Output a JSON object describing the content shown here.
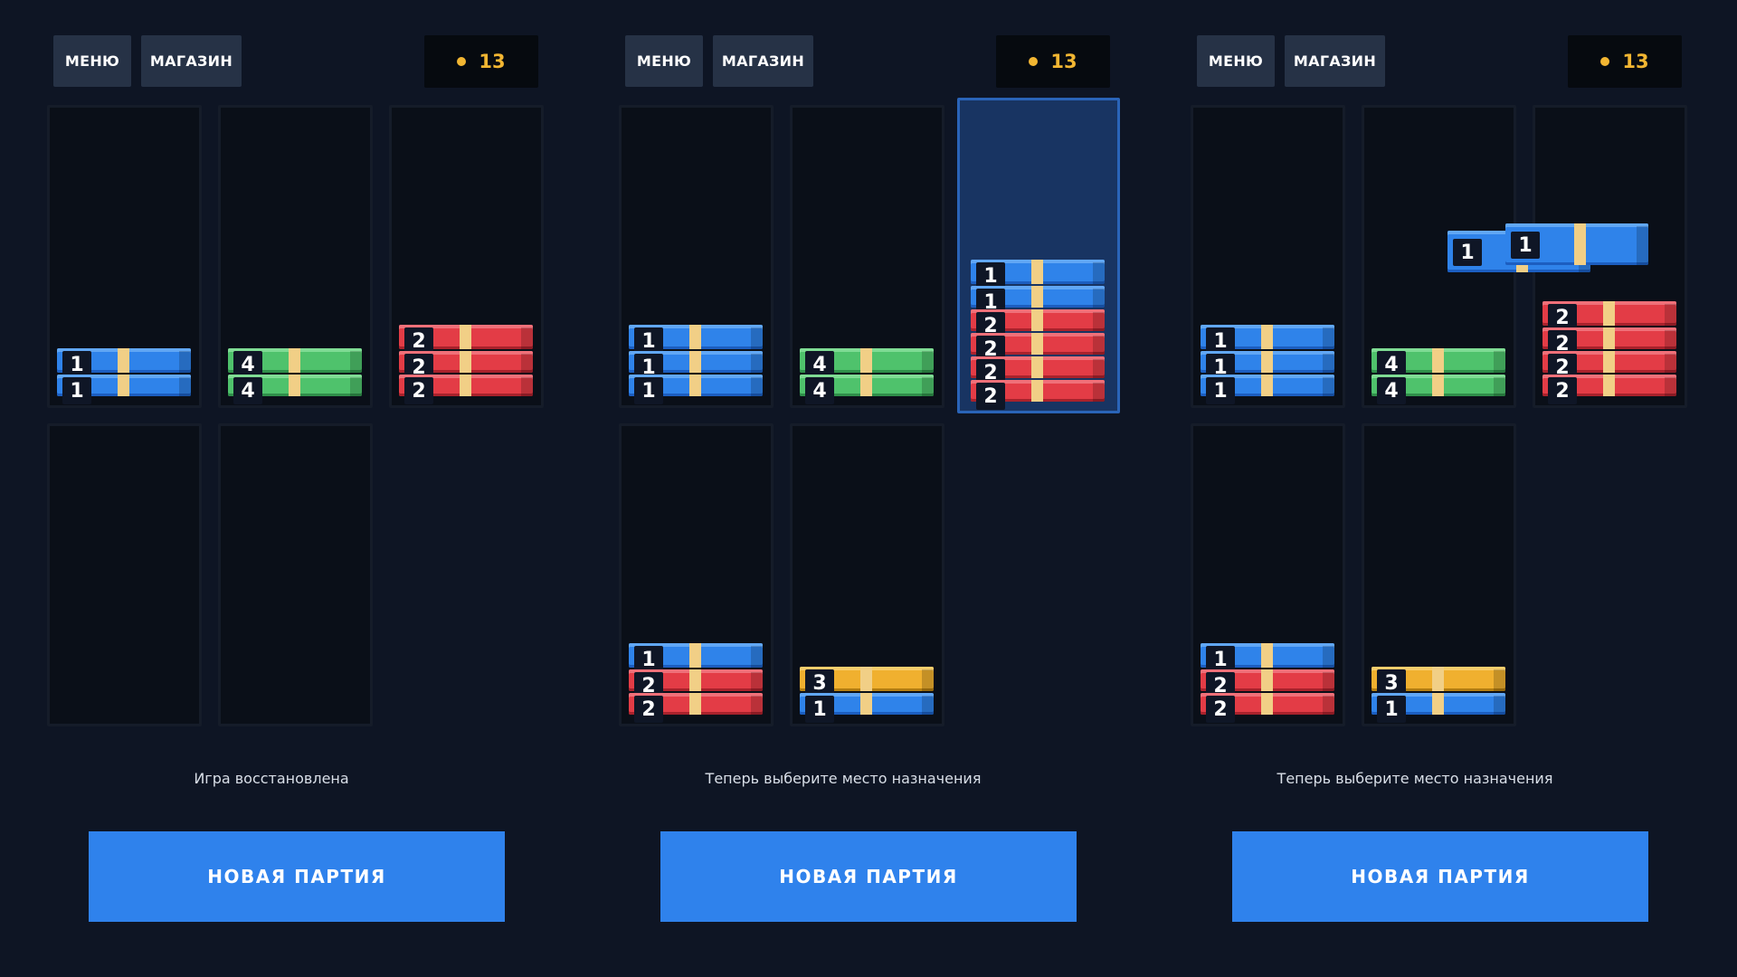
{
  "panels": [
    {
      "header": {
        "menu_label": "МЕНЮ",
        "shop_label": "МАГАЗИН",
        "coins": "13"
      },
      "status": "Игра восстановлена",
      "new_game_label": "НОВАЯ ПАРТИЯ",
      "columns": [
        {
          "selected": false,
          "bundles": [
            "1",
            "1"
          ],
          "colors": [
            "blue",
            "blue"
          ]
        },
        {
          "selected": false,
          "bundles": [
            "4",
            "4"
          ],
          "colors": [
            "green",
            "green"
          ]
        },
        {
          "selected": false,
          "bundles": [
            "2",
            "2",
            "2"
          ],
          "colors": [
            "red",
            "red",
            "red"
          ]
        },
        {
          "selected": false,
          "bundles": [],
          "colors": []
        },
        {
          "selected": false,
          "bundles": [],
          "colors": []
        }
      ]
    },
    {
      "header": {
        "menu_label": "МЕНЮ",
        "shop_label": "МАГАЗИН",
        "coins": "13"
      },
      "status": "Теперь выберите место назначения",
      "new_game_label": "НОВАЯ ПАРТИЯ",
      "columns": [
        {
          "selected": false,
          "bundles": [
            "1",
            "1",
            "1"
          ],
          "colors": [
            "blue",
            "blue",
            "blue"
          ]
        },
        {
          "selected": false,
          "bundles": [
            "4",
            "4"
          ],
          "colors": [
            "green",
            "green"
          ]
        },
        {
          "selected": true,
          "bundles": [
            "1",
            "1",
            "2",
            "2",
            "2",
            "2"
          ],
          "colors": [
            "blue",
            "blue",
            "red",
            "red",
            "red",
            "red"
          ]
        },
        {
          "selected": false,
          "bundles": [
            "1",
            "2",
            "2"
          ],
          "colors": [
            "blue",
            "red",
            "red"
          ]
        },
        {
          "selected": false,
          "bundles": [
            "3",
            "1"
          ],
          "colors": [
            "yellow",
            "blue"
          ]
        }
      ]
    },
    {
      "header": {
        "menu_label": "МЕНЮ",
        "shop_label": "МАГАЗИН",
        "coins": "13"
      },
      "status": "Теперь выберите место назначения",
      "new_game_label": "НОВАЯ ПАРТИЯ",
      "columns": [
        {
          "selected": false,
          "bundles": [
            "1",
            "1",
            "1"
          ],
          "colors": [
            "blue",
            "blue",
            "blue"
          ]
        },
        {
          "selected": false,
          "bundles": [
            "4",
            "4"
          ],
          "colors": [
            "green",
            "green"
          ]
        },
        {
          "selected": false,
          "bundles": [
            "2",
            "2",
            "2",
            "2"
          ],
          "colors": [
            "red",
            "red",
            "red",
            "red"
          ]
        },
        {
          "selected": false,
          "bundles": [
            "1",
            "2",
            "2"
          ],
          "colors": [
            "blue",
            "red",
            "red"
          ]
        },
        {
          "selected": false,
          "bundles": [
            "3",
            "1"
          ],
          "colors": [
            "yellow",
            "blue"
          ]
        }
      ],
      "moving_bundles": [
        "1",
        "1"
      ],
      "moving_colors": [
        "blue",
        "blue"
      ]
    }
  ],
  "colors": {
    "background": "#0e1524",
    "accent": "#2f82ec",
    "coin": "#f2b632",
    "selected_column": "#183462"
  }
}
